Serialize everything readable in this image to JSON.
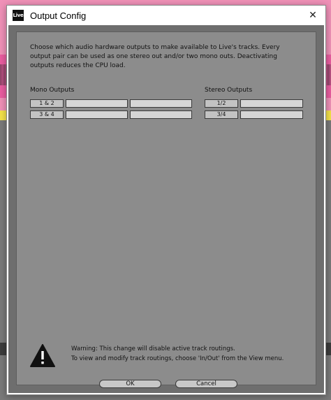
{
  "window": {
    "app_icon_text": "Live",
    "title": "Output Config",
    "close_glyph": "✕"
  },
  "description": "Choose which audio hardware outputs to make available to Live's tracks. Every output pair can be used as one stereo out and/or two mono outs.  Deactivating outputs reduces the CPU load.",
  "mono": {
    "title": "Mono Outputs",
    "rows": [
      {
        "label": "1 & 2"
      },
      {
        "label": "3 & 4"
      }
    ]
  },
  "stereo": {
    "title": "Stereo Outputs",
    "rows": [
      {
        "label": "1/2"
      },
      {
        "label": "3/4"
      }
    ]
  },
  "warning": {
    "icon": "warning-triangle-icon",
    "line1": "Warning: This change will disable active track routings.",
    "line2": "To view and modify track routings, choose 'In/Out' from the View menu."
  },
  "buttons": {
    "ok": "OK",
    "cancel": "Cancel"
  }
}
